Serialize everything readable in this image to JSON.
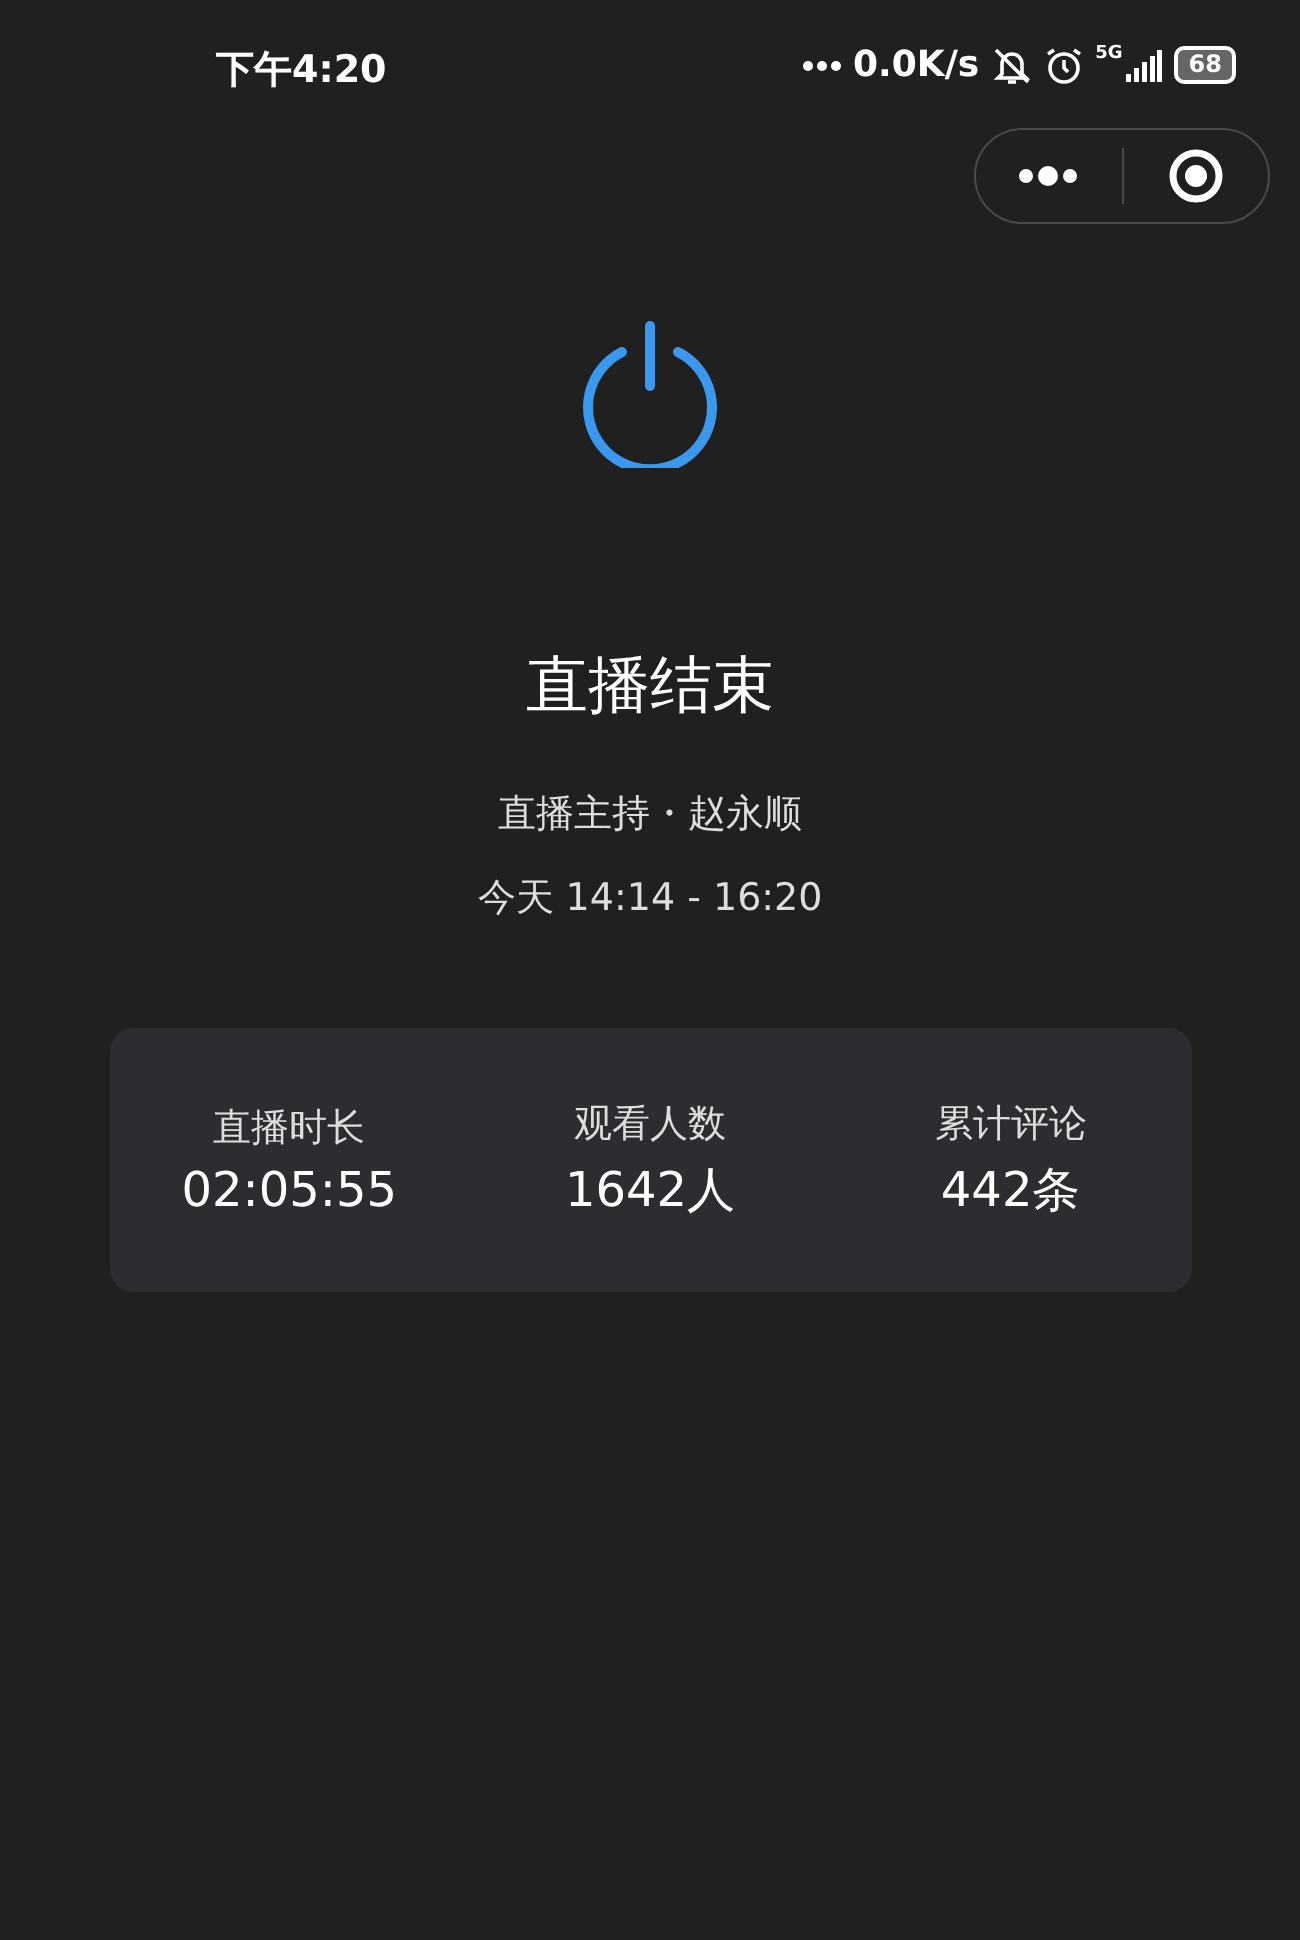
{
  "status_bar": {
    "time": "下午4:20",
    "speed": "0.0K/s",
    "network": "5G",
    "battery": "68"
  },
  "title": "直播结束",
  "host": "直播主持・赵永顺",
  "time_range": "今天 14:14 - 16:20",
  "stats": [
    {
      "label": "直播时长",
      "value": "02:05:55"
    },
    {
      "label": "观看人数",
      "value": "1642人"
    },
    {
      "label": "累计评论",
      "value": "442条"
    }
  ]
}
